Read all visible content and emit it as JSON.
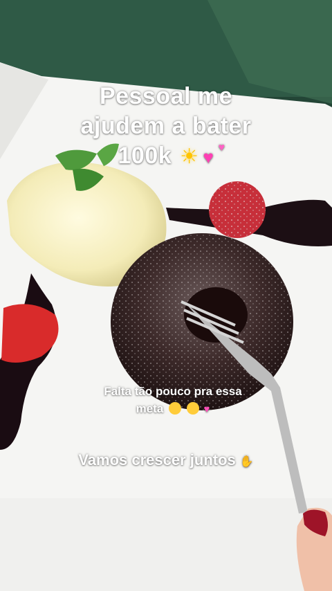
{
  "story": {
    "caption_title_lines": [
      "Pessoal me",
      "ajudem a bater",
      "100k"
    ],
    "caption_title_emoji": [
      "sun-emoji",
      "two-hearts-emoji"
    ],
    "caption_middle_line1": "Falta tão pouco pra essa",
    "caption_middle_line2": "meta",
    "caption_middle_emoji": [
      "pleading-face-emoji",
      "relieved-face-emoji",
      "two-hearts-emoji"
    ],
    "caption_bottom": "Vamos crescer juntos",
    "caption_bottom_emoji": [
      "raising-hands-emoji"
    ]
  }
}
